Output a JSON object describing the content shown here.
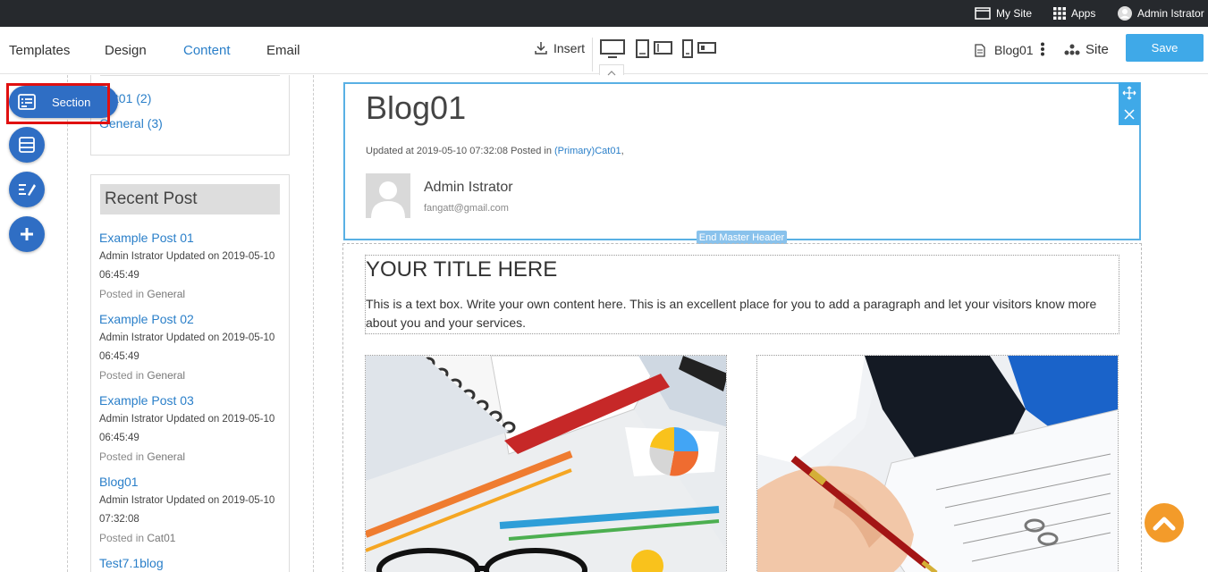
{
  "topbar": {
    "my_site": "My Site",
    "apps": "Apps",
    "user": "Admin Istrator"
  },
  "toolbar": {
    "tabs": [
      "Templates",
      "Design",
      "Content",
      "Email"
    ],
    "active_tab": "Content",
    "insert": "Insert",
    "page_selector": "Blog01",
    "site": "Site",
    "save": "Save"
  },
  "sidebar_tools": {
    "section_label": "Section"
  },
  "sidebar": {
    "categories": [
      "Cat01 (2)",
      "General (3)"
    ],
    "recent_heading": "Recent Post",
    "posts": [
      {
        "title": "Example Post 01",
        "meta": "Admin Istrator Updated on 2019-05-10 06:45:49",
        "posted_in_label": "Posted in",
        "category": "General"
      },
      {
        "title": "Example Post 02",
        "meta": "Admin Istrator Updated on 2019-05-10 06:45:49",
        "posted_in_label": "Posted in",
        "category": "General"
      },
      {
        "title": "Example Post 03",
        "meta": "Admin Istrator Updated on 2019-05-10 06:45:49",
        "posted_in_label": "Posted in",
        "category": "General"
      },
      {
        "title": "Blog01",
        "meta": "Admin Istrator Updated on 2019-05-10 07:32:08",
        "posted_in_label": "Posted in",
        "category": "Cat01"
      },
      {
        "title": "Test7.1blog",
        "meta": "",
        "posted_in_label": "",
        "category": ""
      }
    ]
  },
  "header": {
    "title": "Blog01",
    "meta_prefix": "Updated at 2019-05-10 07:32:08 Posted in ",
    "meta_category": "(Primary)Cat01",
    "meta_suffix": ",",
    "author": "Admin Istrator",
    "email": "fangatt@gmail.com",
    "end_label": "End Master Header"
  },
  "content": {
    "title": "YOUR TITLE HERE",
    "body": "This is a text box. Write your own content here. This is an excellent place for you to add a paragraph and let your visitors know more about you and your services."
  },
  "colors": {
    "accent": "#2a7fc9",
    "save": "#3fa9e8",
    "fab": "#2f6ec4",
    "highlight": "#e01010",
    "scroll_top": "#f39b2a"
  }
}
